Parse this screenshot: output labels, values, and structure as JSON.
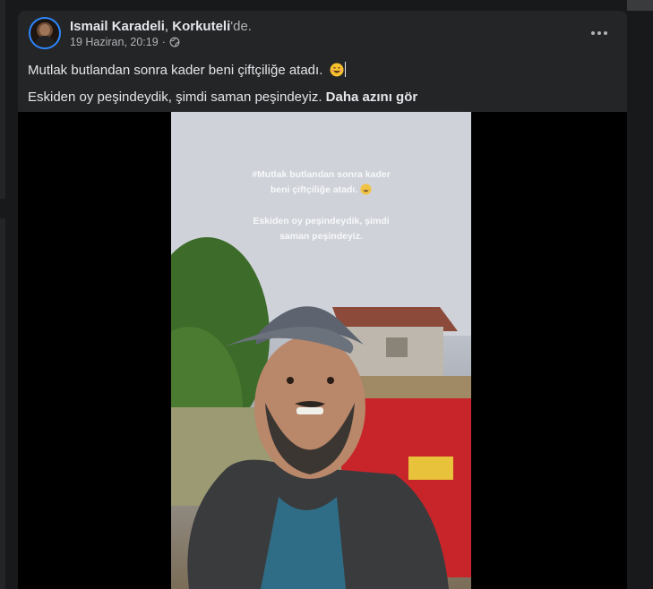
{
  "post": {
    "author": "Ismail Karadeli",
    "separator": ",",
    "location": "Korkuteli",
    "location_suffix": "'de.",
    "date": "19 Haziran, 20:19",
    "date_separator": "·",
    "audience_icon": "globe-icon",
    "more_icon": "more-options-icon",
    "text_line1": "Mutlak butlandan sonra kader beni çiftçiliğe atadı.",
    "emoji": "grinning-face-icon",
    "text_line2": "Eskiden oy peşindeydik, şimdi saman peşindeyiz.",
    "see_more": "Daha azını gör"
  },
  "video": {
    "overlay_line1": "#Mutlak butlandan sonra kader",
    "overlay_line2": "beni çiftçiliğe atadı.",
    "overlay_line3": "Eskiden oy peşindeydik, şimdi",
    "overlay_line4": "saman peşindeyiz."
  },
  "colors": {
    "background": "#18191a",
    "card": "#242526",
    "text": "#e4e6eb",
    "secondary_text": "#b0b3b8",
    "avatar_ring": "#2d88ff"
  }
}
